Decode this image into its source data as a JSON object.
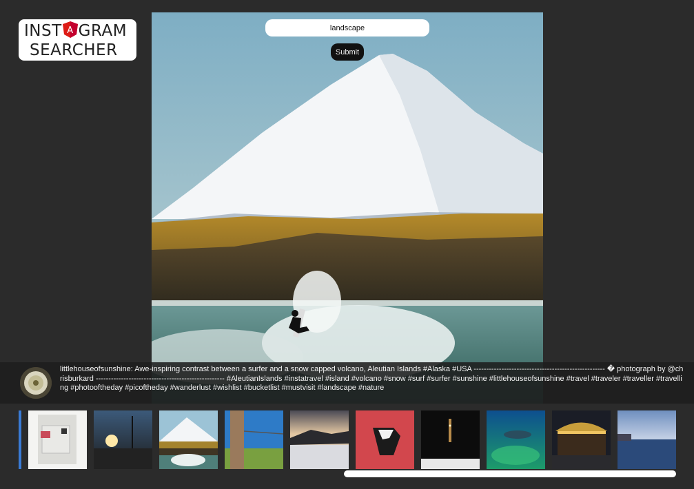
{
  "logo": {
    "line1_before": "INST",
    "line1_after": "GRAM",
    "line2": "SEARCHER",
    "shield_letter": "A"
  },
  "search": {
    "value": "landscape",
    "submit_label": "Submit"
  },
  "caption": {
    "username": "littlehouseofsunshine",
    "text": "littlehouseofsunshine: Awe-inspiring contrast between a surfer and a snow capped volcano, Aleutian Islands #Alaska #USA ---------------------------------------------------- � photograph by @chrisburkard --------------------------------------------------- #AleutianIslands #instatravel #island #volcano #snow #surf #surfer #sunshine #littlehouseofsunshine #travel #traveler #traveller #travelling #photooftheday #picoftheday #wanderlust #wishlist #bucketlist #mustvisit #landscape #nature"
  },
  "colors": {
    "background": "#2b2b2b",
    "caption_bg": "#1e1e1e",
    "angular_red": "#dd1b16"
  },
  "thumbnails": [
    {
      "name": "thumb-partial",
      "desc": "partial"
    },
    {
      "name": "thumb-papers",
      "desc": "papers"
    },
    {
      "name": "thumb-sunset-pole",
      "desc": "sunset"
    },
    {
      "name": "thumb-volcano-surfer",
      "desc": "volcano"
    },
    {
      "name": "thumb-fence-post",
      "desc": "fence"
    },
    {
      "name": "thumb-snow-road",
      "desc": "snow"
    },
    {
      "name": "thumb-red-art",
      "desc": "red"
    },
    {
      "name": "thumb-dark-tower",
      "desc": "tower"
    },
    {
      "name": "thumb-reef",
      "desc": "reef"
    },
    {
      "name": "thumb-carousel",
      "desc": "carousel"
    },
    {
      "name": "thumb-seascape",
      "desc": "sea"
    }
  ]
}
